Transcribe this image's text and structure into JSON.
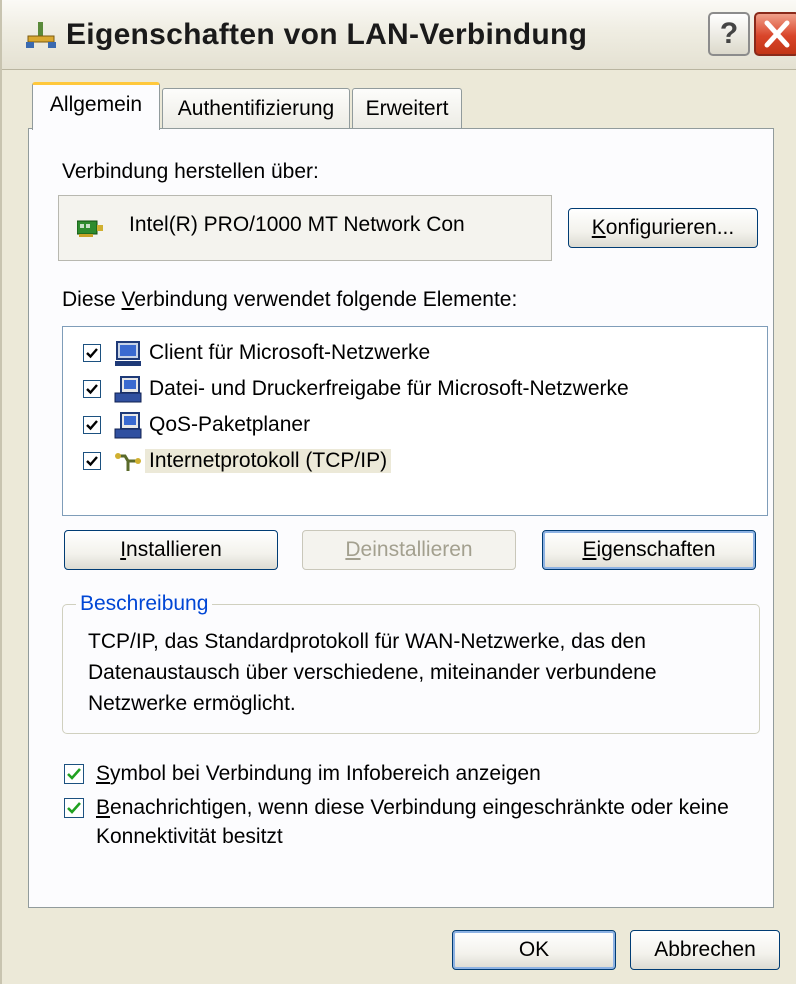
{
  "window": {
    "title": "Eigenschaften von LAN-Verbindung",
    "help_button": "?"
  },
  "tabs": [
    {
      "label": "Allgemein",
      "active": true
    },
    {
      "label": "Authentifizierung",
      "active": false
    },
    {
      "label": "Erweitert",
      "active": false
    }
  ],
  "general": {
    "connect_using_label": "Verbindung herstellen über:",
    "adapter_name": "Intel(R) PRO/1000 MT Network Con",
    "configure_button": {
      "before": "",
      "accel": "K",
      "after": "onfigurieren..."
    },
    "components_label": {
      "before": "Diese ",
      "accel": "V",
      "after": "erbindung verwendet folgende Elemente:"
    },
    "components": [
      {
        "label": "Client für Microsoft-Netzwerke",
        "checked": true,
        "icon": "client-network-icon"
      },
      {
        "label": "Datei- und Druckerfreigabe für Microsoft-Netzwerke",
        "checked": true,
        "icon": "file-printer-sharing-icon"
      },
      {
        "label": "QoS-Paketplaner",
        "checked": true,
        "icon": "qos-scheduler-icon"
      },
      {
        "label": "Internetprotokoll (TCP/IP)",
        "checked": true,
        "icon": "protocol-icon",
        "selected": true
      }
    ],
    "install_button": {
      "before": "",
      "accel": "I",
      "after": "nstallieren"
    },
    "uninstall_button": {
      "before": "",
      "accel": "D",
      "after": "einstallieren",
      "disabled": true
    },
    "properties_button": {
      "before": "",
      "accel": "E",
      "after": "igenschaften"
    },
    "description_title": "Beschreibung",
    "description_text": "TCP/IP, das Standardprotokoll für WAN-Netzwerke, das den Datenaustausch über verschiedene, miteinander verbundene Netzwerke ermöglicht.",
    "show_icon_option": {
      "before": "",
      "accel": "S",
      "after": "ymbol bei Verbindung im Infobereich anzeigen",
      "checked": true
    },
    "notify_option": {
      "before": "",
      "accel": "B",
      "after": "enachrichtigen, wenn diese Verbindung eingeschränkte oder keine Konnektivität besitzt",
      "checked": true
    }
  },
  "footer": {
    "ok_button": "OK",
    "cancel_button": "Abbrechen"
  },
  "colors": {
    "dialog_background": "#ece9d8",
    "panel_background": "#fcfcfe",
    "active_tab_accent": "#ffc83c",
    "close_button": "#d9452a",
    "groupbox_title": "#0046d5",
    "checkmark_green": "#21a121",
    "checkmark_black": "#000000"
  }
}
